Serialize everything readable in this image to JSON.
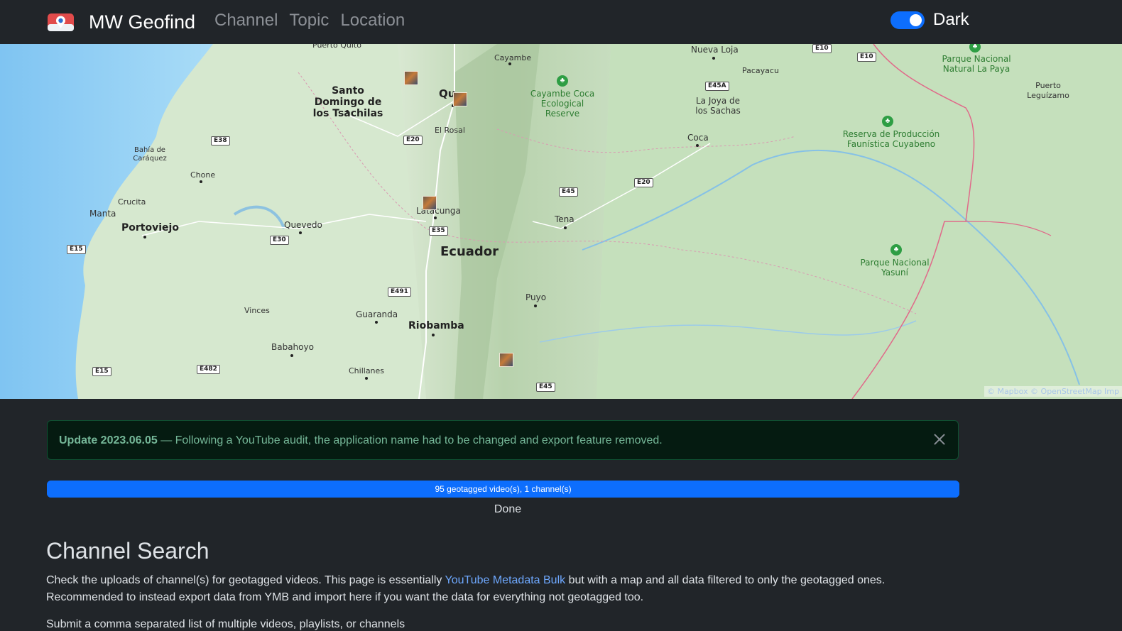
{
  "navbar": {
    "brand": "MW Geofind",
    "links": [
      "Channel",
      "Topic",
      "Location"
    ],
    "theme_label": "Dark",
    "theme_enabled": true
  },
  "map": {
    "country_label": "Ecuador",
    "cities": [
      "Quito",
      "Santo Domingo de los Tsachilas",
      "Portoviejo",
      "Latacunga",
      "Riobamba"
    ],
    "towns": [
      "Puerto Quito",
      "Cayambe",
      "Nueva Loja",
      "Pacayacu",
      "La Joya de los Sachas",
      "Coca",
      "El Rosal",
      "Bahía de Caráquez",
      "Chone",
      "Crucita",
      "Manta",
      "Quevedo",
      "Tena",
      "Puyo",
      "Vinces",
      "Guaranda",
      "Babahoyo",
      "Chillanes",
      "Puerto Leguízamo"
    ],
    "parks": [
      "Cayambe Coca Ecological Reserve",
      "Parque Nacional Natural La Paya",
      "Reserva de Producción Faunística Cuyabeno",
      "Parque Nacional Yasuní"
    ],
    "roads": [
      "E10",
      "E10",
      "E45A",
      "E38",
      "E20",
      "E20",
      "E45",
      "E35",
      "E30",
      "E15",
      "E491",
      "E15",
      "E482",
      "E45"
    ],
    "attribution": "© Mapbox © OpenStreetMap Imp"
  },
  "alert": {
    "title": "Update 2023.06.05",
    "message": " — Following a YouTube audit, the application name had to be changed and export feature removed."
  },
  "progress": {
    "text": "95 geotagged video(s), 1 channel(s)",
    "percent": 100
  },
  "status": "Done",
  "content": {
    "title": "Channel Search",
    "desc_before": "Check the uploads of channel(s) for geotagged videos. This page is essentially ",
    "desc_link": "YouTube Metadata Bulk",
    "desc_after": " but with a map and all data filtered to only the geotagged ones. Recommended to instead export data from YMB and import here if you want the data for everything not geotagged too.",
    "submit_hint": "Submit a comma separated list of multiple videos, playlists, or channels"
  }
}
